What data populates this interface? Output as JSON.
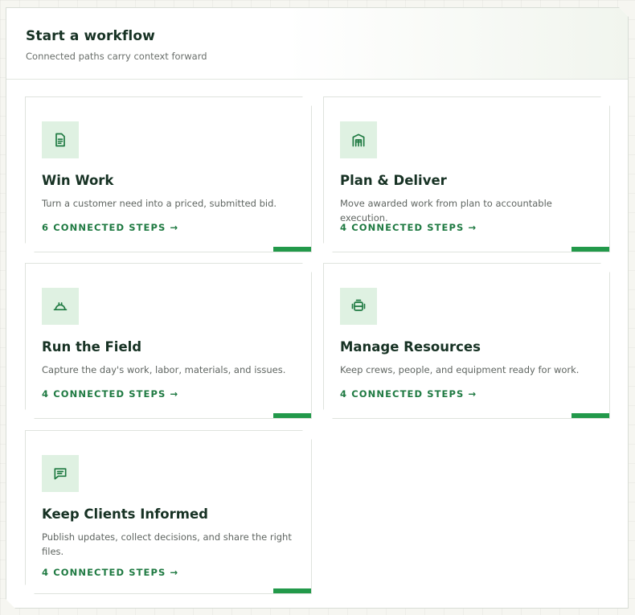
{
  "header": {
    "title": "Start a workflow",
    "subtitle": "Connected paths carry context forward"
  },
  "colors": {
    "accent": "#22994a",
    "link": "#1f7a42",
    "icon_bg": "#dff1e2",
    "title": "#173224"
  },
  "workflows": [
    {
      "title": "Win Work",
      "description": "Turn a customer need into a priced, submitted bid.",
      "steps_label": "6 CONNECTED STEPS →",
      "icon": "document-icon"
    },
    {
      "title": "Plan & Deliver",
      "description": "Move awarded work from plan to accountable execution.",
      "steps_label": "4 CONNECTED STEPS →",
      "icon": "warehouse-icon"
    },
    {
      "title": "Run the Field",
      "description": "Capture the day's work, labor, materials, and issues.",
      "steps_label": "4 CONNECTED STEPS →",
      "icon": "hard-hat-icon"
    },
    {
      "title": "Manage Resources",
      "description": "Keep crews, people, and equipment ready for work.",
      "steps_label": "4 CONNECTED STEPS →",
      "icon": "equipment-icon"
    },
    {
      "title": "Keep Clients Informed",
      "description": "Publish updates, collect decisions, and share the right files.",
      "steps_label": "4 CONNECTED STEPS →",
      "icon": "message-icon"
    }
  ]
}
